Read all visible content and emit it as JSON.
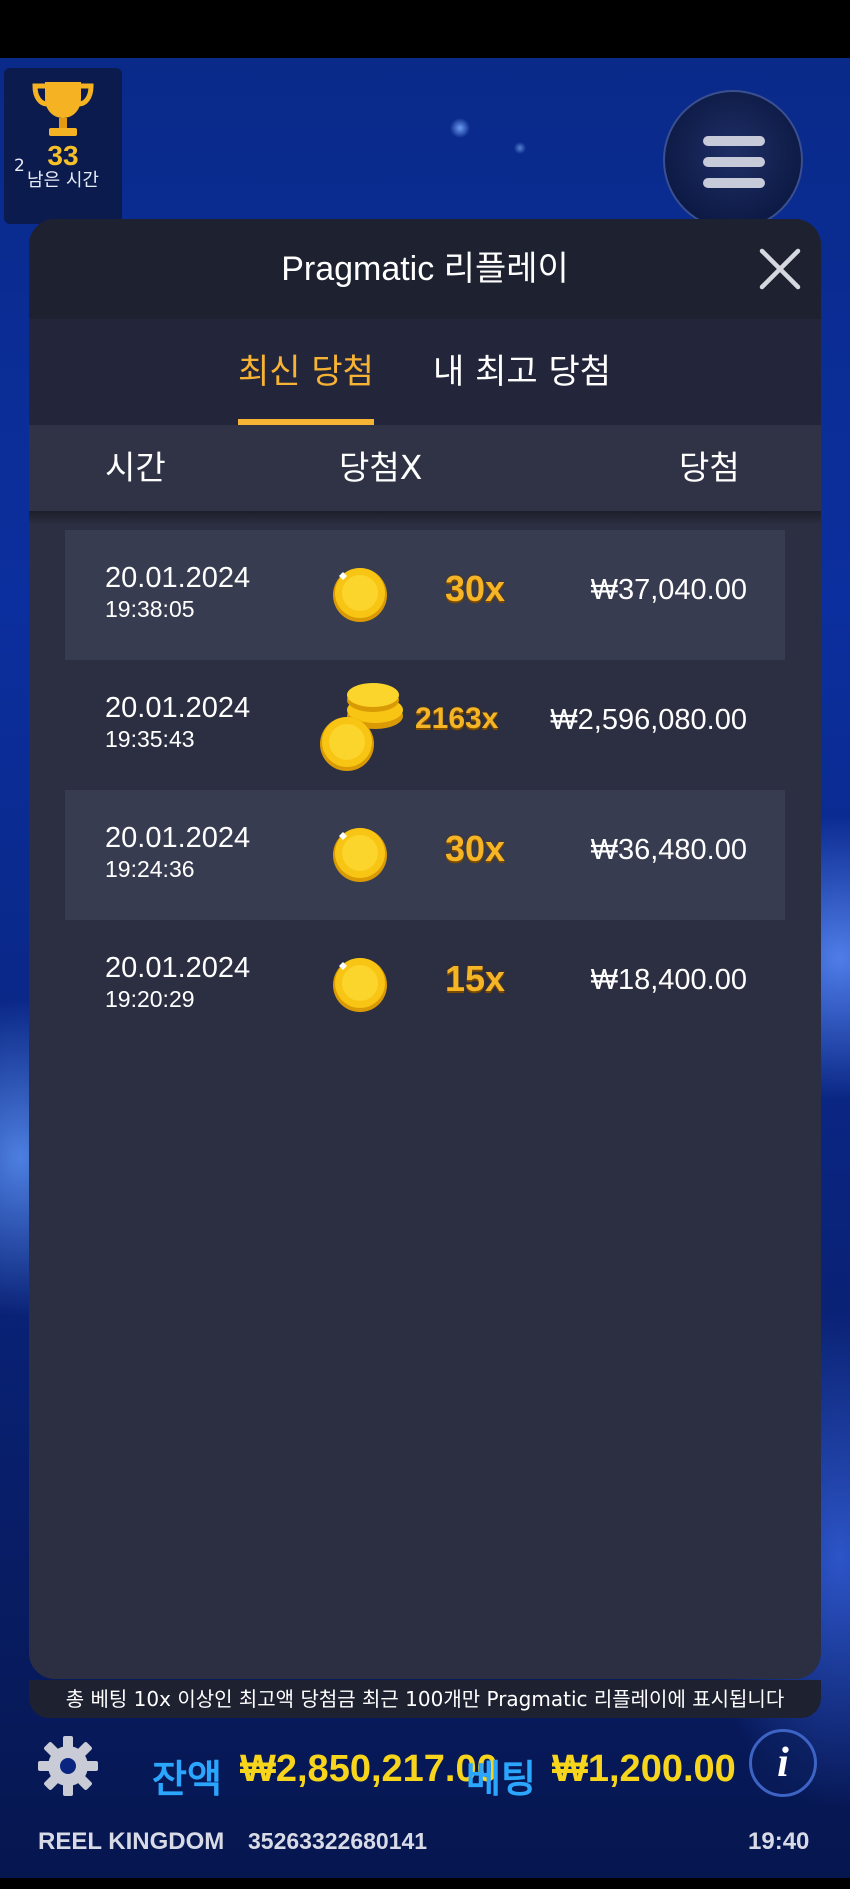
{
  "trophy": {
    "count": "33",
    "label": "남은 시간",
    "sub": "2"
  },
  "modal": {
    "title": "Pragmatic 리플레이",
    "tabs": [
      {
        "label": "최신 당첨",
        "active": true
      },
      {
        "label": "내 최고 당첨",
        "active": false
      }
    ],
    "columns": {
      "time": "시간",
      "multiplier": "당첨X",
      "win": "당첨"
    },
    "rows": [
      {
        "date": "20.01.2024",
        "time": "19:38:05",
        "multiplier": "30x",
        "win": "₩37,040.00",
        "icon": "single-coin-icon"
      },
      {
        "date": "20.01.2024",
        "time": "19:35:43",
        "multiplier": "2163x",
        "win": "₩2,596,080.00",
        "icon": "coin-stack-icon"
      },
      {
        "date": "20.01.2024",
        "time": "19:24:36",
        "multiplier": "30x",
        "win": "₩36,480.00",
        "icon": "single-coin-icon"
      },
      {
        "date": "20.01.2024",
        "time": "19:20:29",
        "multiplier": "15x",
        "win": "₩18,400.00",
        "icon": "single-coin-icon"
      }
    ],
    "footer_note": "총 베팅 10x 이상인 최고액 당첨금 최근 100개만 Pragmatic 리플레이에 표시됩니다"
  },
  "bottom_bar": {
    "balance_label": "잔액",
    "balance_value": "₩2,850,217.00",
    "bet_label": "베팅",
    "bet_value": "₩1,200.00",
    "brand": "REEL KINGDOM",
    "session_id": "35263322680141",
    "clock": "19:40"
  },
  "colors": {
    "accent": "#f7b334",
    "modal_bg": "#2c2f41",
    "balance_label": "#2aa6ff",
    "balance_value": "#f7d51c"
  }
}
